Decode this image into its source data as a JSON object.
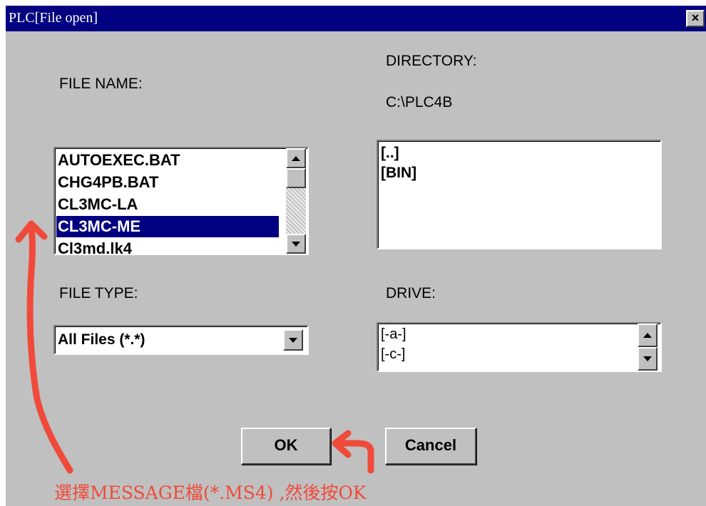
{
  "window": {
    "title": "PLC[File open]",
    "close_glyph": "×"
  },
  "labels": {
    "file_name": "FILE NAME:",
    "directory": "DIRECTORY:",
    "directory_path": "C:\\PLC4B",
    "file_type": "FILE TYPE:",
    "drive": "DRIVE:"
  },
  "file_list": {
    "items": [
      "AUTOEXEC.BAT",
      "CHG4PB.BAT",
      "CL3MC-LA",
      "CL3MC-ME",
      "Cl3md.lk4"
    ],
    "selected_index": 3
  },
  "directory_list": {
    "items": [
      "[..]",
      "[BIN]"
    ]
  },
  "file_type_select": {
    "value": "All Files (*.*)"
  },
  "drive_list": {
    "items": [
      "[-a-]",
      "[-c-]"
    ]
  },
  "buttons": {
    "ok": "OK",
    "cancel": "Cancel"
  },
  "annotation": {
    "text": "選擇MESSAGE檔(*.MS4) ,然後按OK",
    "color": "#f04a3a",
    "icons": [
      "arrow-to-list-icon",
      "arrow-to-ok-icon"
    ]
  }
}
